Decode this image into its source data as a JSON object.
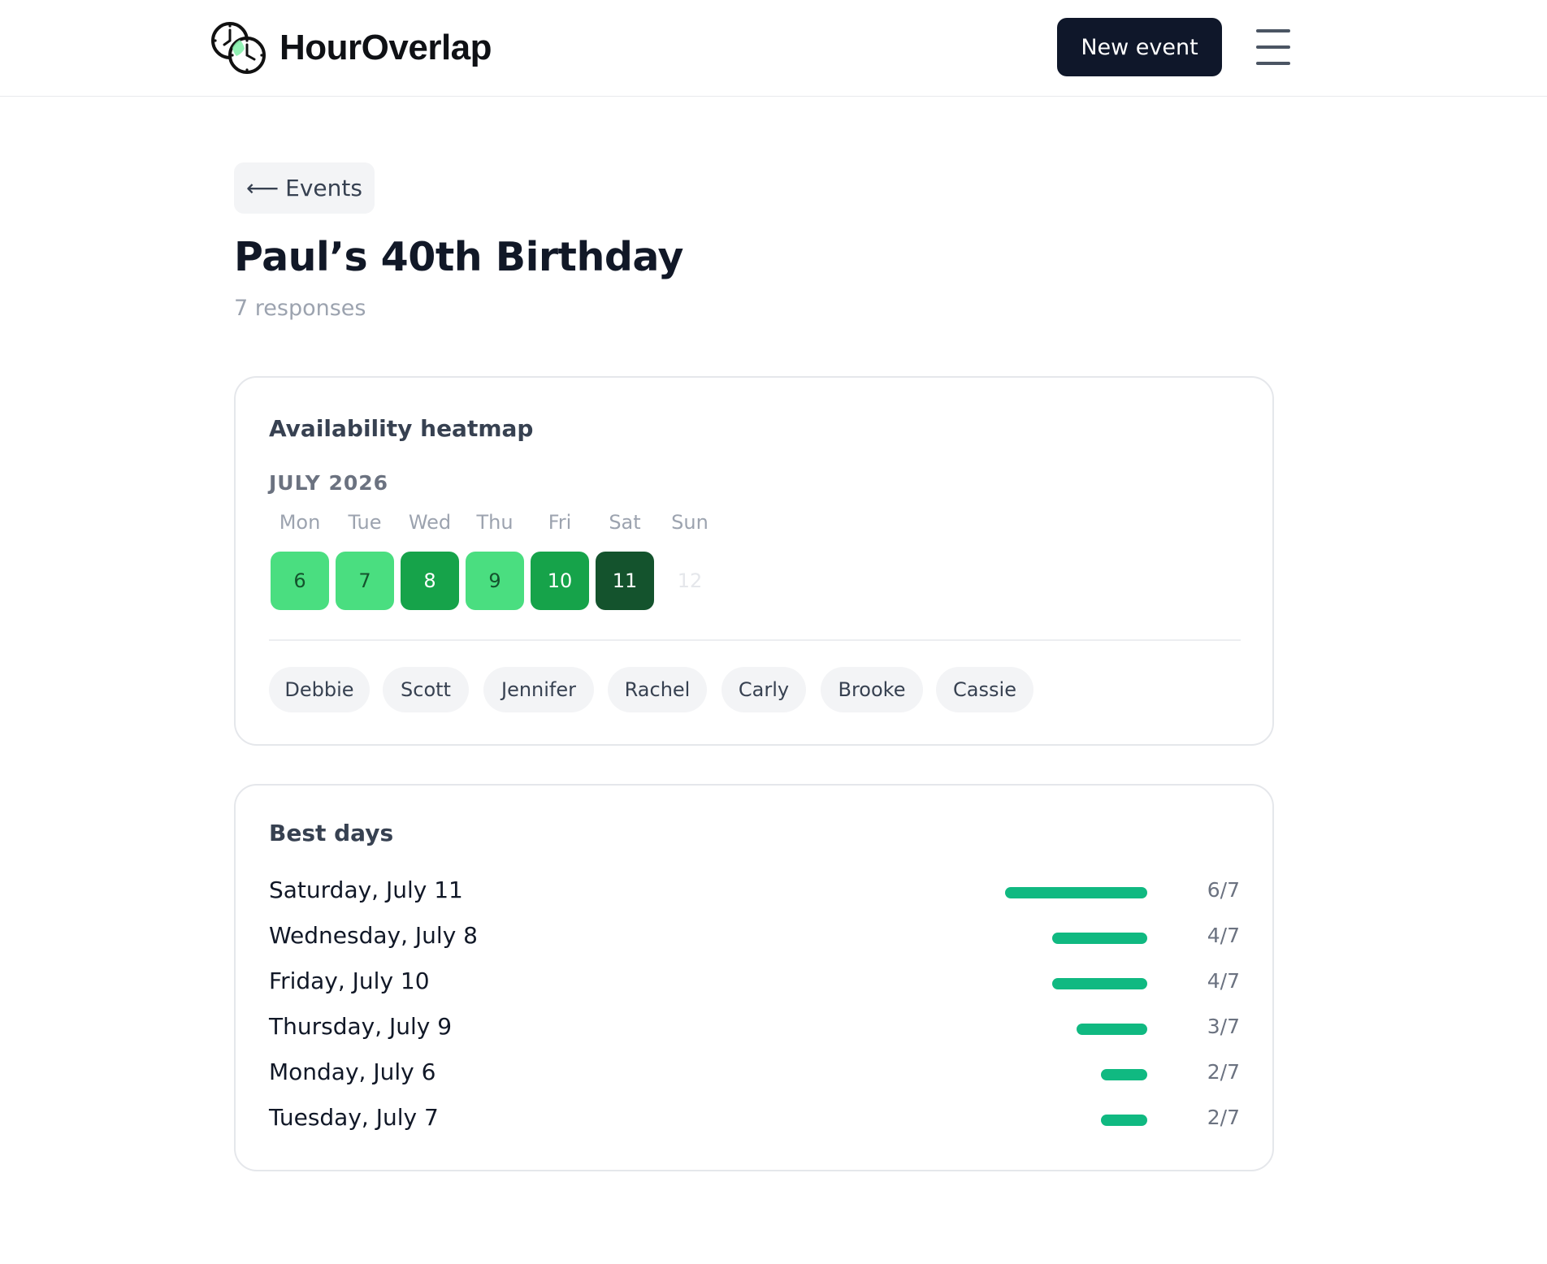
{
  "header": {
    "brand": "HourOverlap",
    "logo_icon": "overlapping-clocks-icon",
    "new_event_label": "New event",
    "menu_icon": "hamburger-menu-icon"
  },
  "back": {
    "arrow": "⟵",
    "label": "Events"
  },
  "event": {
    "title": "Paul’s 40th Birthday",
    "responses": "7 responses"
  },
  "heatmap": {
    "title": "Availability heatmap",
    "month": "JULY 2026",
    "weekdays": [
      "Mon",
      "Tue",
      "Wed",
      "Thu",
      "Fri",
      "Sat",
      "Sun"
    ],
    "days": [
      {
        "label": "6",
        "count": 2,
        "color": "#4ade80",
        "text_color": "#14532d"
      },
      {
        "label": "7",
        "count": 2,
        "color": "#4ade80",
        "text_color": "#14532d"
      },
      {
        "label": "8",
        "count": 4,
        "color": "#16a34a",
        "text_color": "#ffffff"
      },
      {
        "label": "9",
        "count": 3,
        "color": "#4ade80",
        "text_color": "#14532d"
      },
      {
        "label": "10",
        "count": 4,
        "color": "#16a34a",
        "text_color": "#ffffff"
      },
      {
        "label": "11",
        "count": 6,
        "color": "#14532d",
        "text_color": "#ffffff"
      },
      {
        "label": "12",
        "count": 0,
        "color": "transparent",
        "text_color": "#e5e7eb"
      }
    ],
    "participants": [
      "Debbie",
      "Scott",
      "Jennifer",
      "Rachel",
      "Carly",
      "Brooke",
      "Cassie"
    ]
  },
  "best_days": {
    "title": "Best days",
    "accent": "#10b981",
    "total": 7,
    "rows": [
      {
        "label": "Saturday, July 11",
        "count": 6,
        "score": "6/7"
      },
      {
        "label": "Wednesday, July 8",
        "count": 4,
        "score": "4/7"
      },
      {
        "label": "Friday, July 10",
        "count": 4,
        "score": "4/7"
      },
      {
        "label": "Thursday, July 9",
        "count": 3,
        "score": "3/7"
      },
      {
        "label": "Monday, July 6",
        "count": 2,
        "score": "2/7"
      },
      {
        "label": "Tuesday, July 7",
        "count": 2,
        "score": "2/7"
      }
    ]
  }
}
